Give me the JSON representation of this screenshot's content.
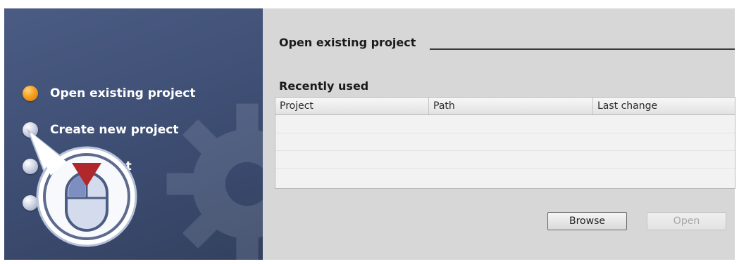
{
  "sidebar": {
    "items": [
      {
        "label": "Open existing project",
        "state": "active"
      },
      {
        "label": "Create new project",
        "state": "idle"
      },
      {
        "label": "ect",
        "state": "idle"
      },
      {
        "label": "",
        "state": "idle"
      }
    ]
  },
  "main": {
    "section_title": "Open existing project",
    "recent_title": "Recently used",
    "table": {
      "columns": [
        "Project",
        "Path",
        "Last change"
      ],
      "rows": []
    },
    "buttons": {
      "browse": "Browse",
      "open": "Open"
    }
  },
  "colors": {
    "sidebar_bg": "#3f4f75",
    "main_bg": "#d7d7d7",
    "active_bullet": "#f6a11f",
    "pointer_triangle": "#b0282b"
  },
  "icons": [
    "gear-icon",
    "mouse-icon",
    "pointer-triangle-icon"
  ]
}
